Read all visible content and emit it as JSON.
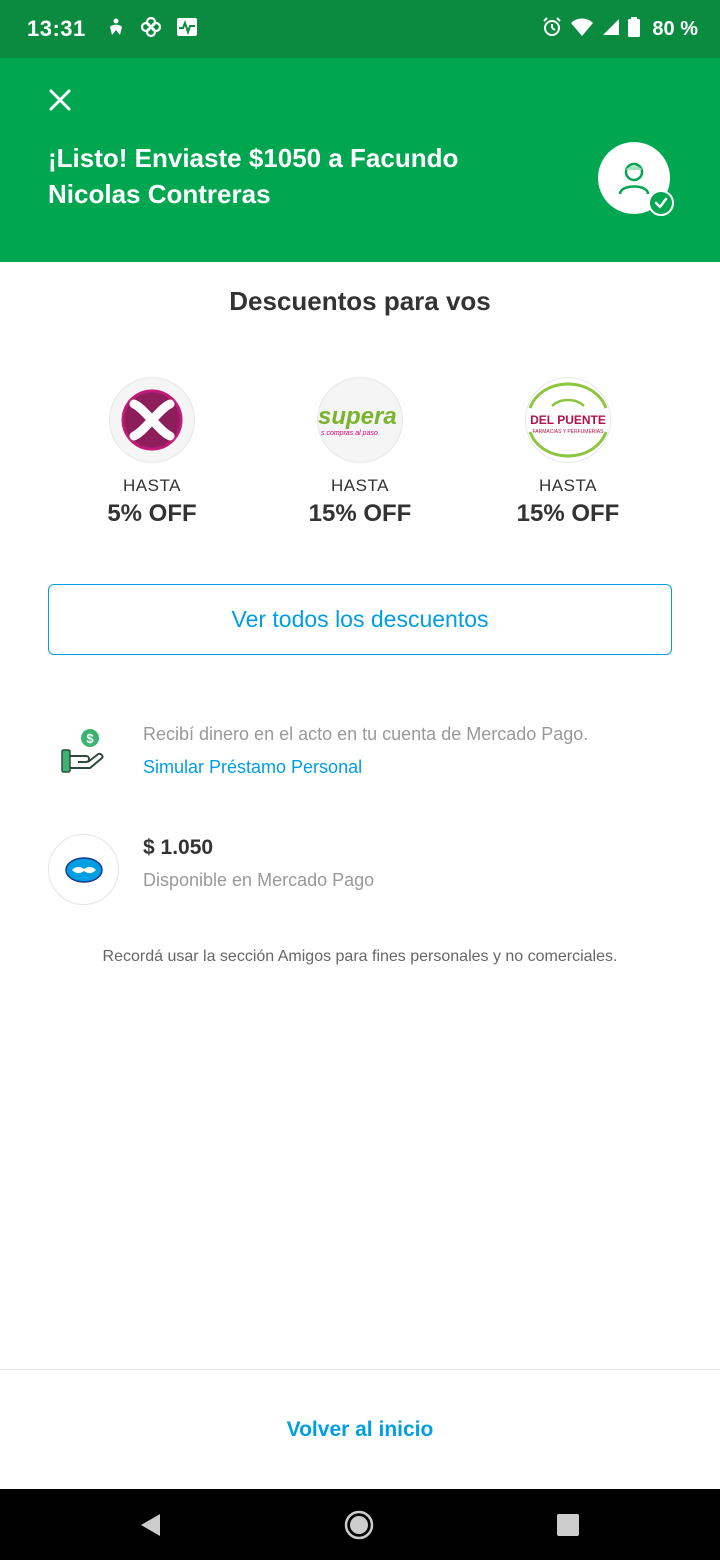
{
  "status_bar": {
    "time": "13:31",
    "battery": "80 %",
    "icons": [
      "accessibility-icon",
      "pinwheel-icon",
      "activity-icon",
      "alarm-icon",
      "wifi-icon",
      "signal-icon",
      "battery-icon"
    ]
  },
  "header": {
    "title": "¡Listo! Enviaste $1050 a Facundo Nicolas Contreras",
    "close_icon": "close-icon",
    "avatar_icon": "user-icon"
  },
  "discounts": {
    "title": "Descuentos para vos",
    "items": [
      {
        "logo": "X",
        "upto": "HASTA",
        "value": "5% OFF"
      },
      {
        "logo": "supera",
        "tagline": "s compras al paso",
        "upto": "HASTA",
        "value": "15% OFF"
      },
      {
        "logo": "DEL PUENTE",
        "tagline": "FARMACIAS Y PERFUMERIAS",
        "upto": "HASTA",
        "value": "15% OFF"
      }
    ],
    "see_all": "Ver todos los descuentos"
  },
  "loan": {
    "text": "Recibí dinero en el acto en tu cuenta de Mercado Pago.",
    "link": "Simular Préstamo Personal"
  },
  "balance": {
    "amount": "$ 1.050",
    "caption": "Disponible en Mercado Pago"
  },
  "disclaimer": "Recordá usar la sección Amigos para fines personales y no comerciales.",
  "footer": {
    "back_home": "Volver al inicio"
  },
  "colors": {
    "status_bar": "#0b8b3f",
    "header": "#00a650",
    "link": "#009ee3"
  }
}
